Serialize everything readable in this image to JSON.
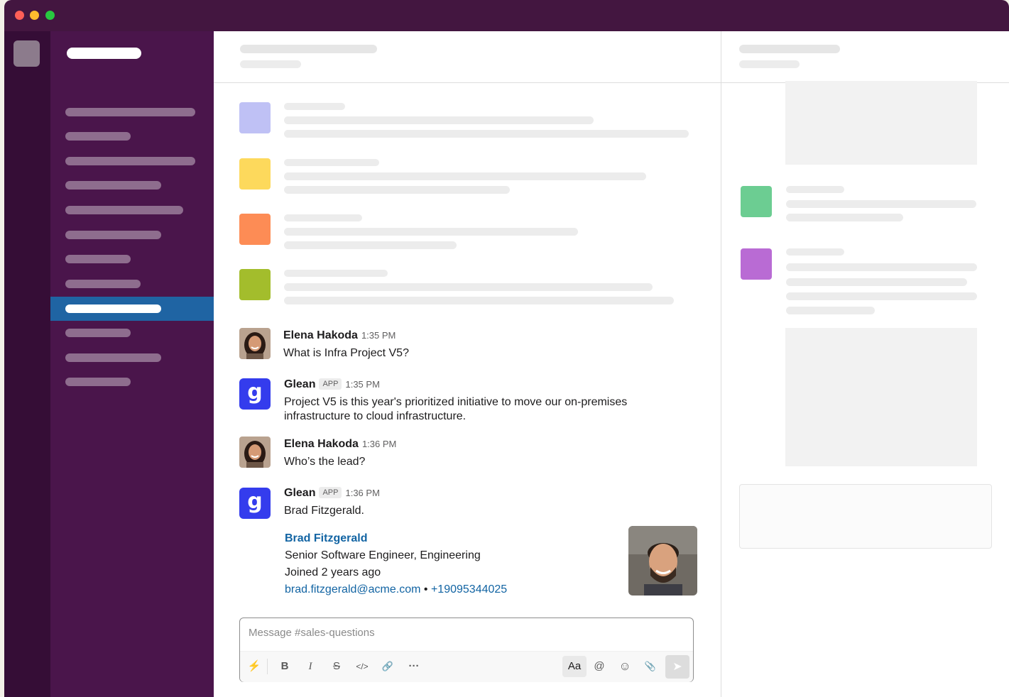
{
  "window": {
    "controls": [
      {
        "name": "close",
        "color": "#ff5f57"
      },
      {
        "name": "minimize",
        "color": "#febc2e"
      },
      {
        "name": "zoom",
        "color": "#28c840"
      }
    ]
  },
  "theme": {
    "sidebar_bg": "#4a154b",
    "rail_bg": "#350d36",
    "active_item": "#1f64a3",
    "link": "#1264a3",
    "glean_brand": "#343ced"
  },
  "placeholder_squares": {
    "main": [
      "#bfc1f5",
      "#fdd95c",
      "#fd8c55",
      "#a3bd2c"
    ],
    "right": [
      "#6ccd92",
      "#b96bd4"
    ]
  },
  "messages": [
    {
      "author": "Elena Hakoda",
      "time": "1:35 PM",
      "text": "What is Infra Project V5?"
    },
    {
      "author": "Glean",
      "badge": "APP",
      "time": "1:35 PM",
      "text": "Project V5 is this year's prioritized initiative to move our on-premises infrastructure to cloud infrastructure."
    },
    {
      "author": "Elena Hakoda",
      "time": "1:36 PM",
      "text": "Who’s the lead?"
    },
    {
      "author": "Glean",
      "badge": "APP",
      "time": "1:36 PM",
      "text": "Brad Fitzgerald."
    }
  ],
  "card": {
    "name": "Brad Fitzgerald",
    "title": "Senior Software Engineer, Engineering",
    "joined": "Joined 2 years ago",
    "email": "brad.fitzgerald@acme.com",
    "separator": "•",
    "phone": "+19095344025"
  },
  "composer": {
    "placeholder": "Message #sales-questions",
    "tools": {
      "shortcut": "⚡",
      "bold": "B",
      "italic": "I",
      "strike": "S",
      "code": "</>",
      "link": "🔗",
      "more": "···",
      "format": "Aa",
      "mention": "@",
      "emoji": "☺",
      "attach": "📎",
      "send": "➤"
    }
  }
}
